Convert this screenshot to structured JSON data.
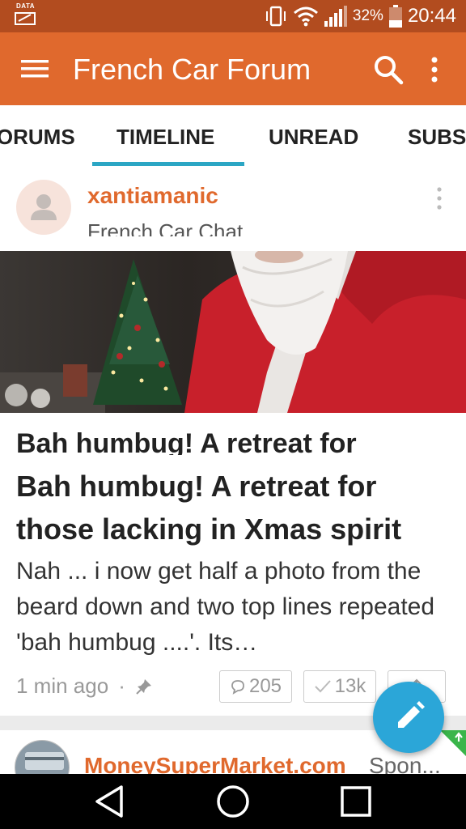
{
  "status_bar": {
    "data_label": "DATA",
    "battery_percent": "32%",
    "time": "20:44"
  },
  "app_bar": {
    "title": "French Car Forum"
  },
  "tabs": [
    {
      "label": "FORUMS",
      "active": false
    },
    {
      "label": "TIMELINE",
      "active": true
    },
    {
      "label": "UNREAD",
      "active": false
    },
    {
      "label": "SUBS",
      "active": false
    }
  ],
  "post": {
    "author": "xantiamanic",
    "forum": "French Car Chat",
    "title_repeat": "Bah humbug! A retreat for",
    "title": "Bah humbug! A retreat for those lacking in Xmas spirit",
    "excerpt": "Nah ... i now get half a photo from the beard down and two top lines repeated 'bah humbug ....'. Its…",
    "time_ago": "1 min ago",
    "separator": "·",
    "reply_count": "205",
    "view_count": "13k"
  },
  "sponsored": {
    "name": "MoneySuperMarket.com",
    "tag": "Spon..."
  },
  "colors": {
    "status_bar": "#b24c1f",
    "app_bar": "#e0692d",
    "accent": "#2ba6c4",
    "fab": "#2ba6d8"
  }
}
